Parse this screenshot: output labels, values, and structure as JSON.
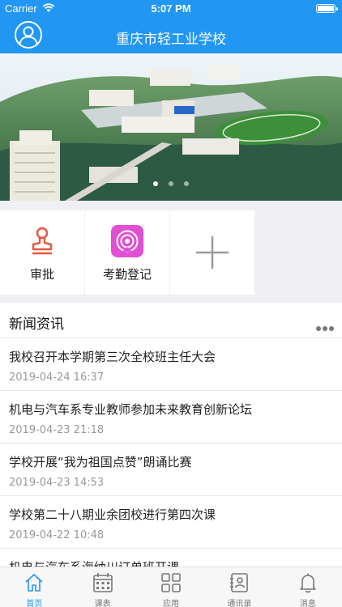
{
  "status_bar": {
    "carrier": "Carrier",
    "time": "5:07 PM"
  },
  "header": {
    "title": "重庆市轻工业学校",
    "avatar_icon": "user-circle-icon"
  },
  "banner": {
    "image": "campus-aerial-photo",
    "page_count": 3,
    "active_page": 1
  },
  "quick_actions": [
    {
      "label": "审批",
      "icon": "stamp-icon",
      "color": "#e8573f"
    },
    {
      "label": "考勤登记",
      "icon": "attendance-signal-icon",
      "color": "#e04fd4"
    },
    {
      "label": "",
      "icon": "plus-icon",
      "color": "#9a9a9a"
    }
  ],
  "news": {
    "title": "新闻资讯",
    "items": [
      {
        "title": "我校召开本学期第三次全校班主任大会",
        "date": "2019-04-24 16:37"
      },
      {
        "title": "机电与汽车系专业教师参加未来教育创新论坛",
        "date": "2019-04-23 21:18"
      },
      {
        "title": "学校开展“我为祖国点赞”朗诵比赛",
        "date": "2019-04-23 14:53"
      },
      {
        "title": "学校第二十八期业余团校进行第四次课",
        "date": "2019-04-22 10:48"
      },
      {
        "title": "机电与汽车系海纳川订单班开课",
        "date": ""
      }
    ]
  },
  "tabbar": {
    "items": [
      {
        "label": "首页",
        "icon": "home-icon",
        "active": true
      },
      {
        "label": "课表",
        "icon": "calendar-icon",
        "active": false
      },
      {
        "label": "应用",
        "icon": "apps-grid-icon",
        "active": false
      },
      {
        "label": "通讯录",
        "icon": "contacts-icon",
        "active": false
      },
      {
        "label": "消息",
        "icon": "bell-icon",
        "active": false
      }
    ]
  },
  "colors": {
    "primary": "#2196f3",
    "background": "#efeff4"
  }
}
